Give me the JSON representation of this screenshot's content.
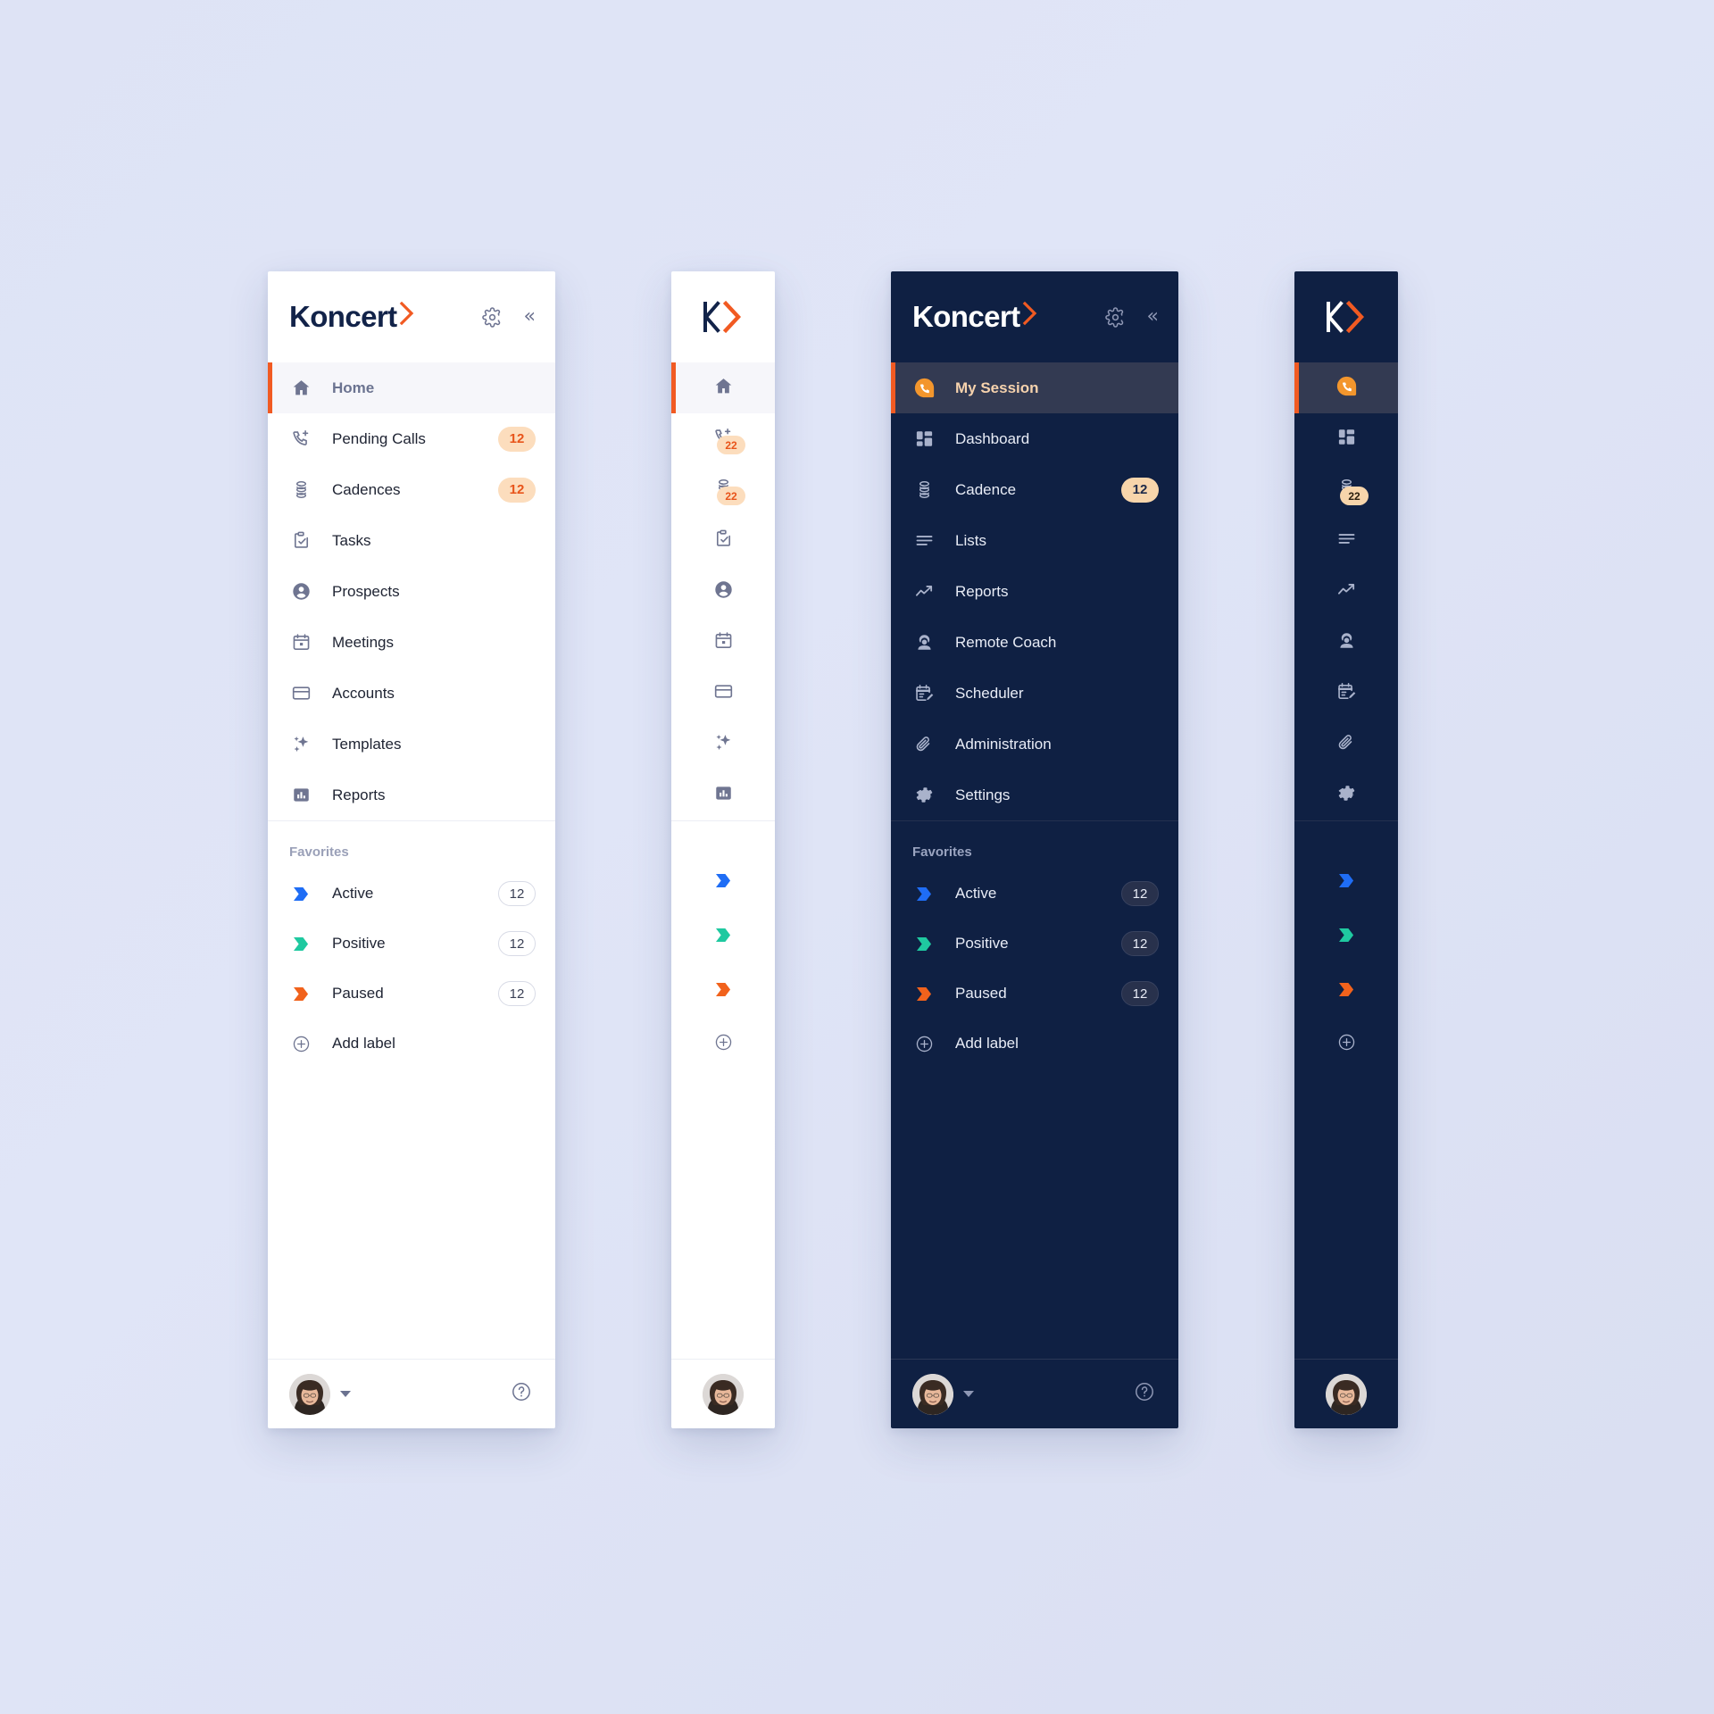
{
  "brand": {
    "wordmark": "Koncert",
    "mark_letter": "K",
    "accent_orange": "#f15a22",
    "navy": "#122349",
    "dark_panel_bg": "#0f2043",
    "light_panel_bg": "#ffffff",
    "canvas_bg": "#dfe4f6"
  },
  "header": {
    "settings_icon": "gear-icon",
    "collapse_icon": "chevron-double-left-icon",
    "collapse_label": "«"
  },
  "panels": [
    {
      "id": "expanded-light",
      "theme": "light",
      "variant": "expanded",
      "title": "Koncert"
    },
    {
      "id": "collapsed-light",
      "theme": "light",
      "variant": "collapsed",
      "title": "K"
    },
    {
      "id": "expanded-dark",
      "theme": "dark",
      "variant": "expanded",
      "title": "Koncert"
    },
    {
      "id": "collapsed-dark",
      "theme": "dark",
      "variant": "collapsed",
      "title": "K"
    }
  ],
  "light_nav": {
    "items": [
      {
        "label": "Home",
        "icon": "home-icon",
        "badge": "",
        "active": true,
        "rail_badge": ""
      },
      {
        "label": "Pending Calls",
        "icon": "phone-plus-icon",
        "badge": "12",
        "active": false,
        "rail_badge": "22"
      },
      {
        "label": "Cadences",
        "icon": "cadence-coil-icon",
        "badge": "12",
        "active": false,
        "rail_badge": "22"
      },
      {
        "label": "Tasks",
        "icon": "clipboard-check-icon",
        "badge": "",
        "active": false,
        "rail_badge": ""
      },
      {
        "label": "Prospects",
        "icon": "person-circle-icon",
        "badge": "",
        "active": false,
        "rail_badge": ""
      },
      {
        "label": "Meetings",
        "icon": "calendar-icon",
        "badge": "",
        "active": false,
        "rail_badge": ""
      },
      {
        "label": "Accounts",
        "icon": "credit-card-icon",
        "badge": "",
        "active": false,
        "rail_badge": ""
      },
      {
        "label": "Templates",
        "icon": "sparkles-icon",
        "badge": "",
        "active": false,
        "rail_badge": ""
      },
      {
        "label": "Reports",
        "icon": "bar-chart-icon",
        "badge": "",
        "active": false,
        "rail_badge": ""
      }
    ]
  },
  "dark_nav": {
    "items": [
      {
        "label": "My Session",
        "icon": "phone-bubble-icon",
        "badge": "",
        "active": true,
        "rail_badge": ""
      },
      {
        "label": "Dashboard",
        "icon": "dashboard-grid-icon",
        "badge": "",
        "active": false,
        "rail_badge": ""
      },
      {
        "label": "Cadence",
        "icon": "cadence-coil-icon",
        "badge": "12",
        "active": false,
        "rail_badge": "22"
      },
      {
        "label": "Lists",
        "icon": "lists-lines-icon",
        "badge": "",
        "active": false,
        "rail_badge": ""
      },
      {
        "label": "Reports",
        "icon": "trend-up-icon",
        "badge": "",
        "active": false,
        "rail_badge": ""
      },
      {
        "label": "Remote Coach",
        "icon": "headset-person-icon",
        "badge": "",
        "active": false,
        "rail_badge": ""
      },
      {
        "label": "Scheduler",
        "icon": "calendar-edit-icon",
        "badge": "",
        "active": false,
        "rail_badge": ""
      },
      {
        "label": "Administration",
        "icon": "paperclip-icon",
        "badge": "",
        "active": false,
        "rail_badge": ""
      },
      {
        "label": "Settings",
        "icon": "gear-icon",
        "badge": "",
        "active": false,
        "rail_badge": ""
      }
    ]
  },
  "favorites": {
    "title": "Favorites",
    "items": [
      {
        "label": "Active",
        "count": "12",
        "color": "#1f6df5",
        "icon": "flag-icon"
      },
      {
        "label": "Positive",
        "count": "12",
        "color": "#1fc9a0",
        "icon": "flag-icon"
      },
      {
        "label": "Paused",
        "count": "12",
        "color": "#f1621c",
        "icon": "flag-icon"
      }
    ],
    "add_label": {
      "label": "Add label",
      "icon": "plus-circle-icon"
    }
  },
  "footer": {
    "avatar_icon": "user-avatar",
    "caret_icon": "caret-down-icon",
    "help_icon": "help-circle-icon"
  }
}
